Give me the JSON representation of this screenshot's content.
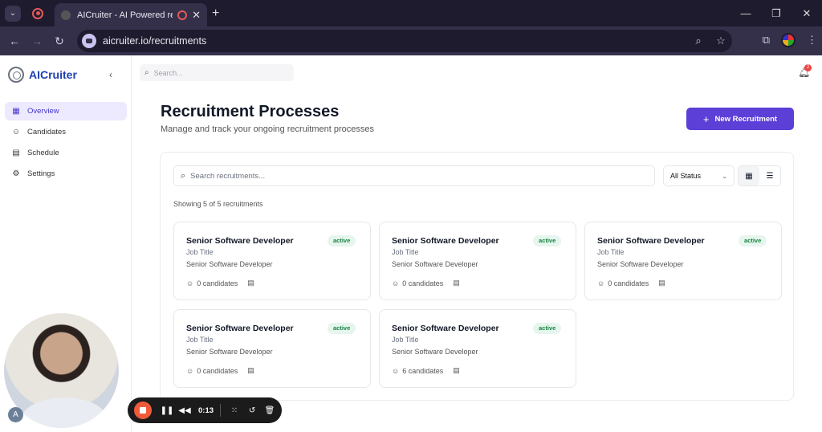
{
  "browser": {
    "tab_title": "AICruiter - AI Powered recr",
    "url": "aicruiter.io/recruitments",
    "new_tab_icon": "plus-icon",
    "window_controls": [
      "minimize-icon",
      "restore-icon",
      "close-icon"
    ]
  },
  "sidebar": {
    "brand": "AICruiter",
    "items": [
      {
        "label": "Overview",
        "icon": "grid-icon",
        "active": true
      },
      {
        "label": "Candidates",
        "icon": "users-icon",
        "active": false
      },
      {
        "label": "Schedule",
        "icon": "calendar-icon",
        "active": false
      },
      {
        "label": "Settings",
        "icon": "gear-icon",
        "active": false
      }
    ]
  },
  "header": {
    "search_placeholder": "Search...",
    "notification_count": "2"
  },
  "main": {
    "title": "Recruitment Processes",
    "subtitle": "Manage and track your ongoing recruitment processes",
    "new_button": "New Recruitment",
    "search_placeholder": "Search recruitments...",
    "status_filter": "All Status",
    "showing": "Showing 5 of 5 recruitments",
    "cards": [
      {
        "title": "Senior Software Developer",
        "status": "active",
        "job_label": "Job Title",
        "job_title": "Senior Software Developer",
        "candidates": "0 candidates"
      },
      {
        "title": "Senior Software Developer",
        "status": "active",
        "job_label": "Job Title",
        "job_title": "Senior Software Developer",
        "candidates": "0 candidates"
      },
      {
        "title": "Senior Software Developer",
        "status": "active",
        "job_label": "Job Title",
        "job_title": "Senior Software Developer",
        "candidates": "0 candidates"
      },
      {
        "title": "Senior Software Developer",
        "status": "active",
        "job_label": "Job Title",
        "job_title": "Senior Software Developer",
        "candidates": "0 candidates"
      },
      {
        "title": "Senior Software Developer",
        "status": "active",
        "job_label": "Job Title",
        "job_title": "Senior Software Developer",
        "candidates": "6 candidates"
      }
    ]
  },
  "recorder": {
    "time": "0:13",
    "avatar_letter": "A"
  },
  "colors": {
    "accent": "#5b3fd6",
    "active_badge_bg": "#e6f6ee",
    "active_badge_text": "#16833f",
    "brand_text": "#1e40af"
  }
}
